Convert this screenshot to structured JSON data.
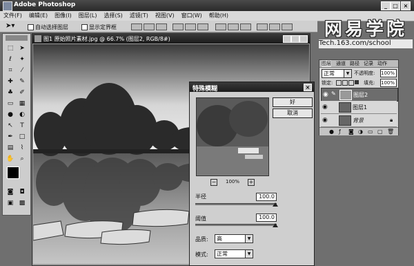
{
  "app": {
    "title": "Adobe Photoshop",
    "win_min": "_",
    "win_max": "□",
    "win_close": "×"
  },
  "menu": [
    "文件(F)",
    "编辑(E)",
    "图像(I)",
    "图层(L)",
    "选择(S)",
    "滤镜(T)",
    "视图(V)",
    "窗口(W)",
    "帮助(H)"
  ],
  "options": {
    "auto_select": "自动选择图层",
    "show_bounds": "显示定界框"
  },
  "brand": {
    "logo": "网易学院",
    "url": "Tech.163.com/school"
  },
  "document": {
    "title": "图1 原始照片素材.jpg @ 66.7% (图层2, RGB/8#)"
  },
  "layers_panel": {
    "tabs": [
      "图层",
      "通道",
      "路径",
      "记录",
      "动作"
    ],
    "blend_mode": "正常",
    "opacity_label": "不透明度:",
    "opacity": "100%",
    "lock_label": "锁定:",
    "fill_label": "填充:",
    "fill": "100%",
    "layers": [
      {
        "name": "图层2",
        "selected": true
      },
      {
        "name": "图层1",
        "selected": false
      },
      {
        "name": "背景",
        "selected": false
      }
    ]
  },
  "dialog": {
    "title": "特殊模糊",
    "ok": "好",
    "cancel": "取消",
    "zoom": "100%",
    "zoom_minus": "−",
    "zoom_plus": "+",
    "radius_label": "半径",
    "radius": "100.0",
    "threshold_label": "阈值",
    "threshold": "100.0",
    "quality_label": "品质:",
    "quality": "高",
    "mode_label": "模式:",
    "mode": "正常"
  },
  "colors": {
    "titlebar": "#2a2a2a",
    "background": "#6f6f6f",
    "dialog": "#cfcfcf"
  }
}
